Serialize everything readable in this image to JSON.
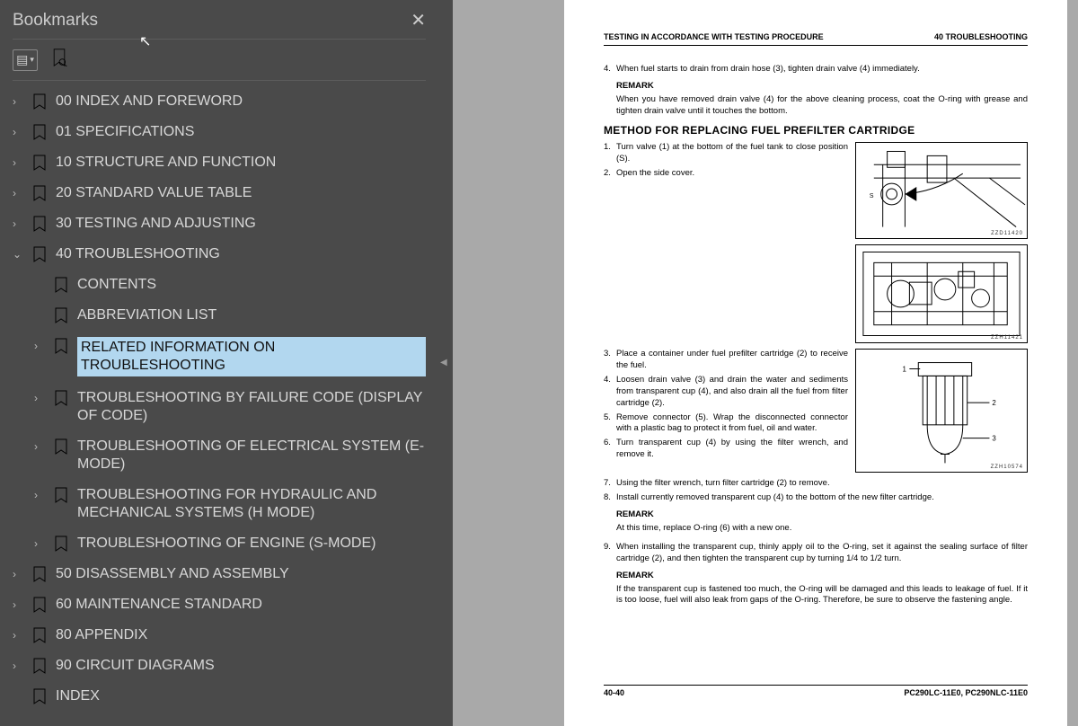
{
  "sidebar": {
    "title": "Bookmarks",
    "items": [
      {
        "label": "00 INDEX AND FOREWORD",
        "expand": true
      },
      {
        "label": "01 SPECIFICATIONS",
        "expand": true
      },
      {
        "label": "10 STRUCTURE AND FUNCTION",
        "expand": true
      },
      {
        "label": "20 STANDARD VALUE TABLE",
        "expand": true
      },
      {
        "label": "30 TESTING AND ADJUSTING",
        "expand": true
      },
      {
        "label": "40 TROUBLESHOOTING",
        "expand": true,
        "open": true,
        "children": [
          {
            "label": "CONTENTS"
          },
          {
            "label": "ABBREVIATION LIST"
          },
          {
            "label": "RELATED INFORMATION ON TROUBLESHOOTING",
            "expand": true,
            "selected": true
          },
          {
            "label": "TROUBLESHOOTING BY FAILURE CODE (DISPLAY OF CODE)",
            "expand": true
          },
          {
            "label": "TROUBLESHOOTING OF ELECTRICAL SYSTEM (E-MODE)",
            "expand": true
          },
          {
            "label": "TROUBLESHOOTING FOR HYDRAULIC AND MECHANICAL SYSTEMS (H MODE)",
            "expand": true
          },
          {
            "label": "TROUBLESHOOTING OF ENGINE (S-MODE)",
            "expand": true
          }
        ]
      },
      {
        "label": "50 DISASSEMBLY AND ASSEMBLY",
        "expand": true
      },
      {
        "label": "60 MAINTENANCE STANDARD",
        "expand": true
      },
      {
        "label": "80 APPENDIX",
        "expand": true
      },
      {
        "label": "90 CIRCUIT DIAGRAMS",
        "expand": true
      },
      {
        "label": "INDEX"
      }
    ]
  },
  "page": {
    "header_left": "TESTING IN ACCORDANCE WITH TESTING PROCEDURE",
    "header_right": "40 TROUBLESHOOTING",
    "step4": "When fuel starts to drain from drain hose (3), tighten drain valve (4) immediately.",
    "remark_label": "REMARK",
    "remark1": "When you have removed drain valve (4) for the above cleaning process, coat the O-ring with grease and tighten drain valve until it touches the bottom.",
    "h2": "METHOD FOR REPLACING FUEL PREFILTER CARTRIDGE",
    "s1": "Turn valve (1) at the bottom of the fuel tank to close position (S).",
    "s2": "Open the side cover.",
    "s3": "Place a container under fuel prefilter cartridge (2) to receive the fuel.",
    "s4": "Loosen drain valve (3) and drain the water and sediments from transparent cup (4), and also drain all the fuel from filter cartridge (2).",
    "s5": "Remove connector (5). Wrap the disconnected connector with a plastic bag to protect it from fuel, oil and water.",
    "s6": "Turn transparent cup (4) by using the filter wrench, and remove it.",
    "s7": "Using the filter wrench, turn filter cartridge (2) to remove.",
    "s8": "Install currently removed transparent cup (4) to the bottom of the new filter cartridge.",
    "r2": "At this time, replace O-ring (6) with a new one.",
    "s9": "When installing the transparent cup, thinly apply oil to the O-ring, set it against the sealing surface of filter cartridge (2), and then tighten the transparent cup by turning 1/4 to 1/2 turn.",
    "r3": "If the transparent cup is fastened too much, the O-ring will be damaged and this leads to leakage of fuel. If it is too loose, fuel will also leak from gaps of the O-ring. Therefore, be sure to observe the fastening angle.",
    "fig_labels": [
      "ZZD11420",
      "ZZH11421",
      "ZZH10574"
    ],
    "footer_left": "40-40",
    "footer_right": "PC290LC-11E0, PC290NLC-11E0"
  }
}
